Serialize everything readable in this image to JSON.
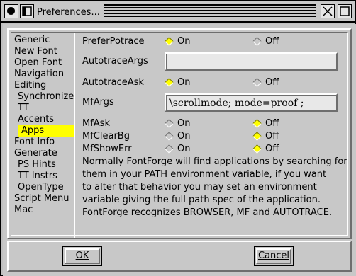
{
  "window": {
    "title": "Preferences..."
  },
  "sidebar": {
    "items": [
      {
        "label": "Generic",
        "sub": false,
        "selected": false
      },
      {
        "label": "New Font",
        "sub": false,
        "selected": false
      },
      {
        "label": "Open Font",
        "sub": false,
        "selected": false
      },
      {
        "label": "Navigation",
        "sub": false,
        "selected": false
      },
      {
        "label": "Editing",
        "sub": false,
        "selected": false
      },
      {
        "label": "Synchronize",
        "sub": true,
        "selected": false
      },
      {
        "label": "TT",
        "sub": true,
        "selected": false
      },
      {
        "label": "Accents",
        "sub": true,
        "selected": false
      },
      {
        "label": "Apps",
        "sub": true,
        "selected": true
      },
      {
        "label": "Font Info",
        "sub": false,
        "selected": false
      },
      {
        "label": "Generate",
        "sub": false,
        "selected": false
      },
      {
        "label": "PS Hints",
        "sub": true,
        "selected": false
      },
      {
        "label": "TT Instrs",
        "sub": true,
        "selected": false
      },
      {
        "label": "OpenType",
        "sub": true,
        "selected": false
      },
      {
        "label": "Script Menu",
        "sub": false,
        "selected": false
      },
      {
        "label": "Mac",
        "sub": false,
        "selected": false
      }
    ]
  },
  "settings": {
    "prefer_potrace": {
      "label": "PreferPotrace",
      "on": "On",
      "off": "Off",
      "value": "On"
    },
    "autotrace_args": {
      "label": "AutotraceArgs",
      "value": ""
    },
    "autotrace_ask": {
      "label": "AutotraceAsk",
      "on": "On",
      "off": "Off",
      "value": "On"
    },
    "mf_args": {
      "label": "MfArgs",
      "value": "\\scrollmode; mode=proof ;"
    },
    "mf_ask": {
      "label": "MfAsk",
      "on": "On",
      "off": "Off",
      "value": "Off"
    },
    "mf_clear_bg": {
      "label": "MfClearBg",
      "on": "On",
      "off": "Off",
      "value": "Off"
    },
    "mf_show_err": {
      "label": "MfShowErr",
      "on": "On",
      "off": "Off",
      "value": "Off"
    }
  },
  "help_lines": [
    "Normally FontForge will find applications by searching for",
    "them in your PATH environment variable, if you want",
    "to alter that behavior you may set an environment",
    "variable giving the full path spec of the application.",
    "FontForge recognizes BROWSER, MF and AUTOTRACE."
  ],
  "buttons": {
    "ok": "OK",
    "cancel": "Cancel"
  },
  "colors": {
    "selection": "#ffff00",
    "background": "#c8c8c8"
  }
}
